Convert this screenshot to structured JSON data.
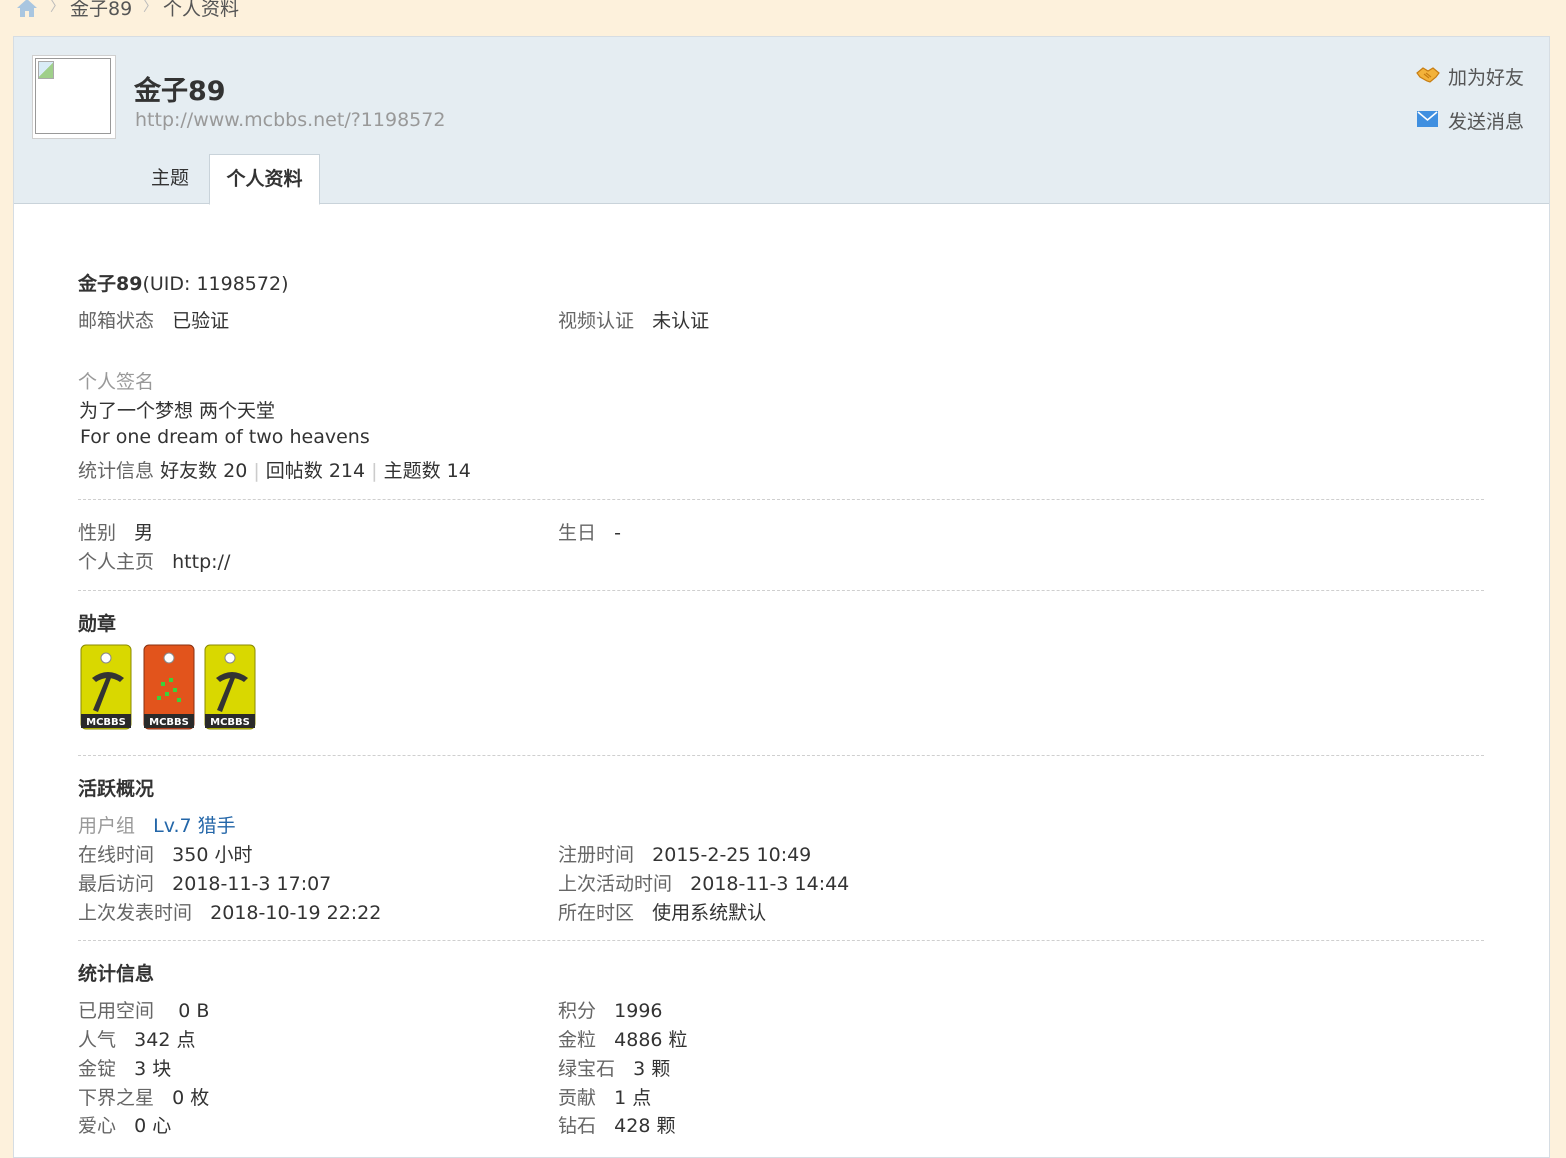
{
  "breadcrumb": {
    "home_icon": "home-icon",
    "items": [
      "金子89",
      "个人资料"
    ]
  },
  "profile": {
    "avatar_icon": "broken-image-icon",
    "name": "金子89",
    "url": "http://www.mcbbs.net/?1198572"
  },
  "actions": {
    "add_friend": "加为好友",
    "send_message": "发送消息"
  },
  "tabs": [
    "主题",
    "个人资料"
  ],
  "basic": {
    "name": "金子89",
    "uid": "(UID: 1198572)",
    "email_label": "邮箱状态",
    "email_value": "已验证",
    "video_label": "视频认证",
    "video_value": "未认证",
    "signature_label": "个人签名",
    "signature_line1": "为了一个梦想 两个天堂",
    "signature_line2": "For one dream of two heavens",
    "stats_label": "统计信息",
    "friends": "好友数 20",
    "replies": "回帖数 214",
    "topics": "主题数 14"
  },
  "personal": {
    "gender_label": "性别",
    "gender_value": "男",
    "birthday_label": "生日",
    "birthday_value": "-",
    "homepage_label": "个人主页",
    "homepage_value": "http://"
  },
  "medals": {
    "title": "勋章",
    "items": [
      {
        "icon": "pickaxe-medal-icon",
        "text": "MCBBS",
        "color": "#d4d400"
      },
      {
        "icon": "grass-medal-icon",
        "text": "MCBBS",
        "color": "#e2541c"
      },
      {
        "icon": "pickaxe-medal-icon",
        "text": "MCBBS",
        "color": "#d4d400"
      }
    ]
  },
  "activity": {
    "title": "活跃概况",
    "group_label": "用户组",
    "group_value": "Lv.7 猎手",
    "online_label": "在线时间",
    "online_value": "350 小时",
    "register_label": "注册时间",
    "register_value": "2015-2-25 10:49",
    "last_visit_label": "最后访问",
    "last_visit_value": "2018-11-3 17:07",
    "last_active_label": "上次活动时间",
    "last_active_value": "2018-11-3 14:44",
    "last_post_label": "上次发表时间",
    "last_post_value": "2018-10-19 22:22",
    "timezone_label": "所在时区",
    "timezone_value": "使用系统默认"
  },
  "statistics": {
    "title": "统计信息",
    "space_label": "已用空间",
    "space_value": "0 B",
    "points_label": "积分",
    "points_value": "1996",
    "popularity_label": "人气",
    "popularity_value": "342 点",
    "gold_nugget_label": "金粒",
    "gold_nugget_value": "4886 粒",
    "gold_ingot_label": "金锭",
    "gold_ingot_value": "3 块",
    "emerald_label": "绿宝石",
    "emerald_value": "3 颗",
    "nether_star_label": "下界之星",
    "nether_star_value": "0 枚",
    "contribution_label": "贡献",
    "contribution_value": "1 点",
    "love_label": "爱心",
    "love_value": "0 心",
    "diamond_label": "钻石",
    "diamond_value": "428 颗"
  },
  "colors": {
    "page_bg": "#fdf1dc",
    "header_bg": "#e5edf2",
    "link": "#2366a8"
  }
}
